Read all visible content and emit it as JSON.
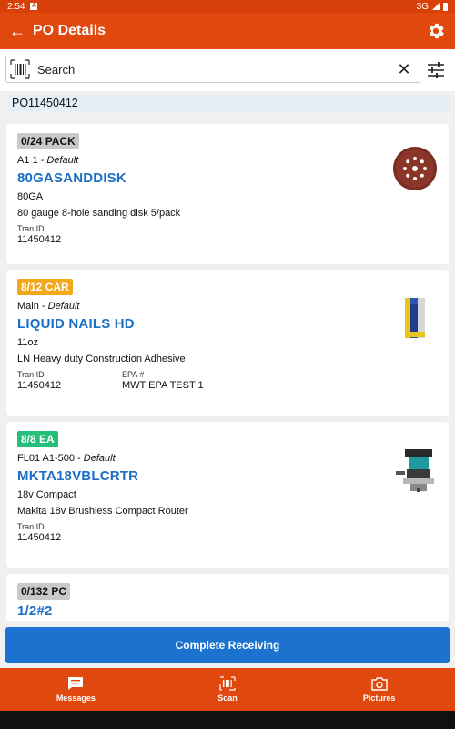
{
  "status_bar": {
    "time": "2:54",
    "network": "3G"
  },
  "app_bar": {
    "title": "PO Details"
  },
  "search": {
    "placeholder": "Search"
  },
  "po_number": "PO11450412",
  "items": [
    {
      "badge": "0/24 PACK",
      "badge_color": "#c9c9c9",
      "location": "A1 1",
      "location_type": "Default",
      "name": "80GASANDDISK",
      "size": "80GA",
      "description": "80 gauge 8-hole sanding disk 5/pack",
      "tran_id_label": "Tran ID",
      "tran_id": "11450412",
      "image_icon": "sanding-disk"
    },
    {
      "badge": "8/12 CAR",
      "badge_color": "#f2a818",
      "location": "Main",
      "location_type": "Default",
      "name": "LIQUID NAILS HD",
      "size": "11oz",
      "description": "LN Heavy duty Construction Adhesive",
      "tran_id_label": "Tran ID",
      "tran_id": "11450412",
      "epa_label": "EPA #",
      "epa": "MWT EPA TEST 1",
      "image_icon": "adhesive-tube"
    },
    {
      "badge": "8/8 EA",
      "badge_color": "#24c07a",
      "location": "FL01 A1-500",
      "location_type": "Default",
      "name": "MKTA18VBLCRTR",
      "size": "18v Compact",
      "description": "Makita 18v Brushless Compact Router",
      "tran_id_label": "Tran ID",
      "tran_id": "11450412",
      "image_icon": "router-tool"
    },
    {
      "badge": "0/132 PC",
      "badge_color": "#c9c9c9",
      "name": "1/2#2"
    }
  ],
  "complete_button": "Complete Receiving",
  "bottom_nav": [
    {
      "label": "Messages",
      "icon": "message-icon"
    },
    {
      "label": "Scan",
      "icon": "barcode-icon"
    },
    {
      "label": "Pictures",
      "icon": "camera-icon"
    }
  ],
  "colors": {
    "brand": "#e0480e",
    "link": "#1b6fc4",
    "button": "#1b73cf"
  }
}
